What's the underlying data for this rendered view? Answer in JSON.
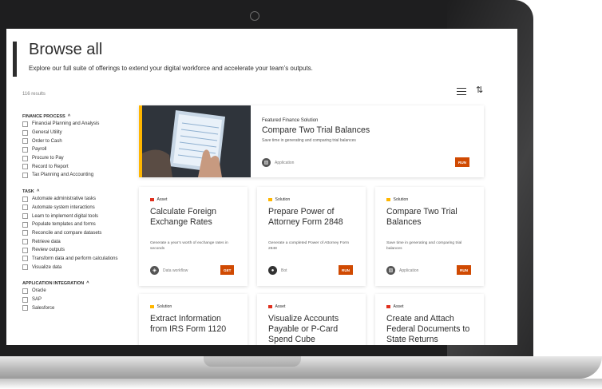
{
  "hero": {
    "title": "Browse all",
    "subtitle": "Explore our full suite of offerings to extend your digital workforce and accelerate your team’s outputs."
  },
  "results_label": "116 results",
  "icons": {
    "list_view": "list-view-icon",
    "sort": "sort-icon"
  },
  "colors": {
    "accent": "#d04a02",
    "featured_stripe": "#ffb600",
    "solution": "#ffb600",
    "asset": "#e0301e"
  },
  "filters": [
    {
      "heading": "FINANCE PROCESS",
      "options": [
        "Financial Planning and Analysis",
        "General Utility",
        "Order to Cash",
        "Payroll",
        "Procure to Pay",
        "Record to Report",
        "Tax Planning and Accounting"
      ]
    },
    {
      "heading": "TASK",
      "options": [
        "Automate administrative tasks",
        "Automate system interactions",
        "Learn to implement digital tools",
        "Populate templates and forms",
        "Reconcile and compare datasets",
        "Retrieve data",
        "Review outputs",
        "Transform data and perform calculations",
        "Visualize data"
      ]
    },
    {
      "heading": "APPLICATION INTEGRATION",
      "options": [
        "Oracle",
        "SAP",
        "Salesforce"
      ]
    }
  ],
  "featured": {
    "kicker": "Featured Finance Solution",
    "title": "Compare Two Trial Balances",
    "description": "Save time in generating and comparing trial balances",
    "type": "Application",
    "button": "RUN"
  },
  "cards": [
    {
      "tag": "Asset",
      "title": "Calculate Foreign Exchange Rates",
      "description": "Generate a year’s worth of exchange rates in seconds",
      "type": "Data workflow",
      "button": "GET"
    },
    {
      "tag": "Solution",
      "title": "Prepare Power of Attorney Form 2848",
      "description": "Generate a completed Power of Attorney Form 2848",
      "type": "Bot",
      "button": "RUN"
    },
    {
      "tag": "Solution",
      "title": "Compare Two Trial Balances",
      "description": "Save time in generating and comparing trial balances",
      "type": "Application",
      "button": "RUN"
    },
    {
      "tag": "Solution",
      "title": "Extract Information from IRS Form 1120"
    },
    {
      "tag": "Asset",
      "title": "Visualize Accounts Payable or P-Card Spend Cube"
    },
    {
      "tag": "Asset",
      "title": "Create and Attach Federal Documents to State Returns"
    }
  ]
}
